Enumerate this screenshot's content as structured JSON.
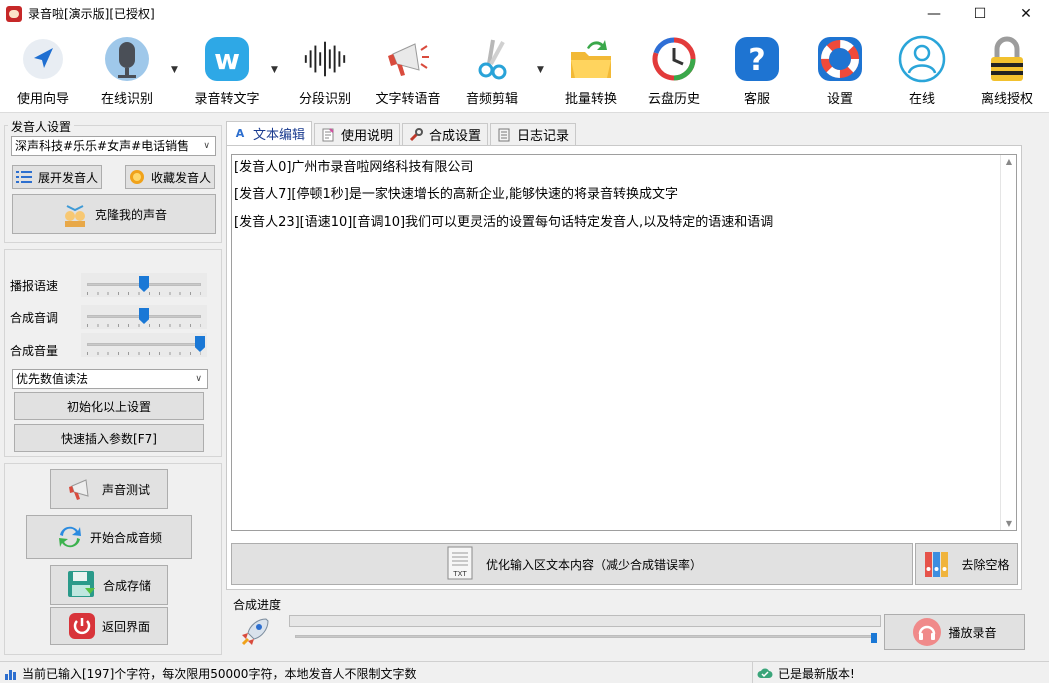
{
  "window": {
    "title": "录音啦[演示版][已授权]",
    "minimize": "—",
    "maximize": "☐",
    "close": "✕"
  },
  "toolbar": {
    "items": [
      {
        "label": "使用向导",
        "icon": "navigation-arrow-icon"
      },
      {
        "label": "在线识别",
        "icon": "microphone-icon"
      },
      {
        "label": "录音转文字",
        "icon": "w-logo-icon"
      },
      {
        "label": "分段识别",
        "icon": "waveform-icon"
      },
      {
        "label": "文字转语音",
        "icon": "megaphone-icon"
      },
      {
        "label": "音频剪辑",
        "icon": "scissors-icon"
      },
      {
        "label": "批量转换",
        "icon": "folder-arrow-icon"
      },
      {
        "label": "云盘历史",
        "icon": "history-clock-icon"
      },
      {
        "label": "客服",
        "icon": "help-icon"
      },
      {
        "label": "设置",
        "icon": "lifebuoy-icon"
      },
      {
        "label": "在线",
        "icon": "user-icon"
      },
      {
        "label": "离线授权",
        "icon": "padlock-icon"
      }
    ]
  },
  "speaker": {
    "legend": "发音人设置",
    "selected": "深声科技#乐乐#女声#电话销售",
    "expand_label": "展开发音人",
    "favorite_label": "收藏发音人",
    "clone_label": "克隆我的声音"
  },
  "params": {
    "speed_label": "播报语速",
    "pitch_label": "合成音调",
    "volume_label": "合成音量",
    "speed_value": 0.5,
    "pitch_value": 0.5,
    "volume_value": 1.0,
    "number_mode": "优先数值读法",
    "reset_label": "初始化以上设置",
    "insert_label": "快速插入参数[F7]"
  },
  "actions": {
    "test_label": "声音测试",
    "start_label": "开始合成音频",
    "save_label": "合成存储",
    "back_label": "返回界面"
  },
  "tabs": [
    {
      "label": "文本编辑"
    },
    {
      "label": "使用说明"
    },
    {
      "label": "合成设置"
    },
    {
      "label": "日志记录"
    }
  ],
  "editor": {
    "lines": [
      "[发音人0]广州市录音啦网络科技有限公司",
      "[发音人7][停顿1秒]是一家快速增长的高新企业,能够快速的将录音转换成文字",
      "[发音人23][语速10][音调10]我们可以更灵活的设置每句话特定发音人,以及特定的语速和语调"
    ]
  },
  "optimize_label": "优化输入区文本内容（减少合成错误率）",
  "remove_spaces_label": "去除空格",
  "progress": {
    "legend": "合成进度",
    "value": 0,
    "play_label": "播放录音",
    "playback_position": 1.0
  },
  "status": {
    "left": "当前已输入[197]个字符，每次限用50000字符，本地发音人不限制文字数",
    "right": "已是最新版本!"
  },
  "colors": {
    "accent": "#1a78d6",
    "link": "#1a3b8f"
  }
}
